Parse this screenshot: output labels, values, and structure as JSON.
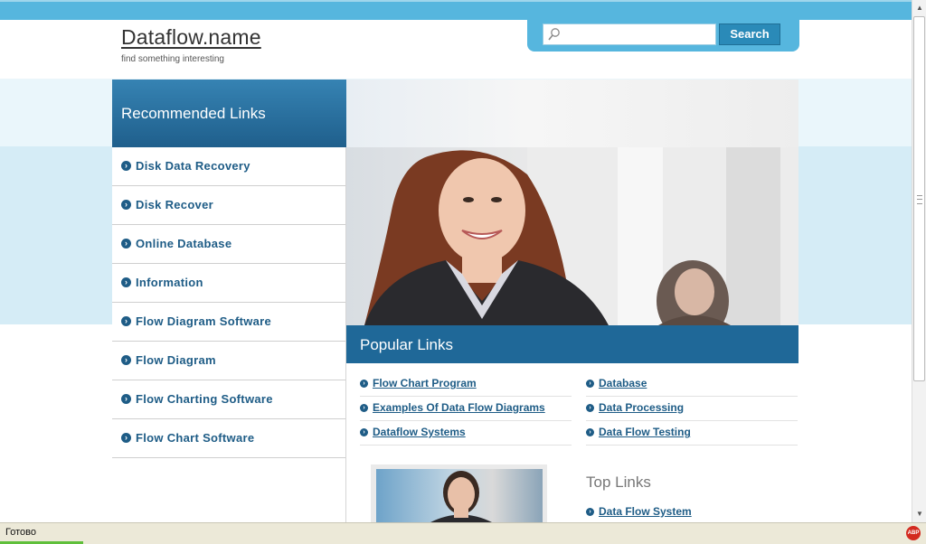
{
  "header": {
    "site_title": "Dataflow.name",
    "tagline": "find something interesting"
  },
  "search": {
    "placeholder": "",
    "value": "",
    "button_label": "Search"
  },
  "sidebar": {
    "heading": "Recommended Links",
    "items": [
      {
        "label": "Disk Data Recovery"
      },
      {
        "label": "Disk Recover"
      },
      {
        "label": "Online Database"
      },
      {
        "label": "Information"
      },
      {
        "label": "Flow Diagram Software"
      },
      {
        "label": "Flow Diagram"
      },
      {
        "label": "Flow Charting Software"
      },
      {
        "label": "Flow Chart Software"
      }
    ]
  },
  "popular": {
    "heading": "Popular Links",
    "left": [
      {
        "label": "Flow Chart Program"
      },
      {
        "label": "Examples Of Data Flow Diagrams"
      },
      {
        "label": "Dataflow Systems"
      }
    ],
    "right": [
      {
        "label": "Database"
      },
      {
        "label": "Data Processing"
      },
      {
        "label": "Data Flow Testing"
      }
    ]
  },
  "top_links": {
    "heading": "Top Links",
    "items": [
      {
        "label": "Data Flow System"
      }
    ]
  },
  "statusbar": {
    "text": "Готово",
    "addon_icon": "ABP"
  },
  "colors": {
    "accent": "#56b6de",
    "nav_dark": "#1f6898",
    "link": "#1e5c86"
  }
}
